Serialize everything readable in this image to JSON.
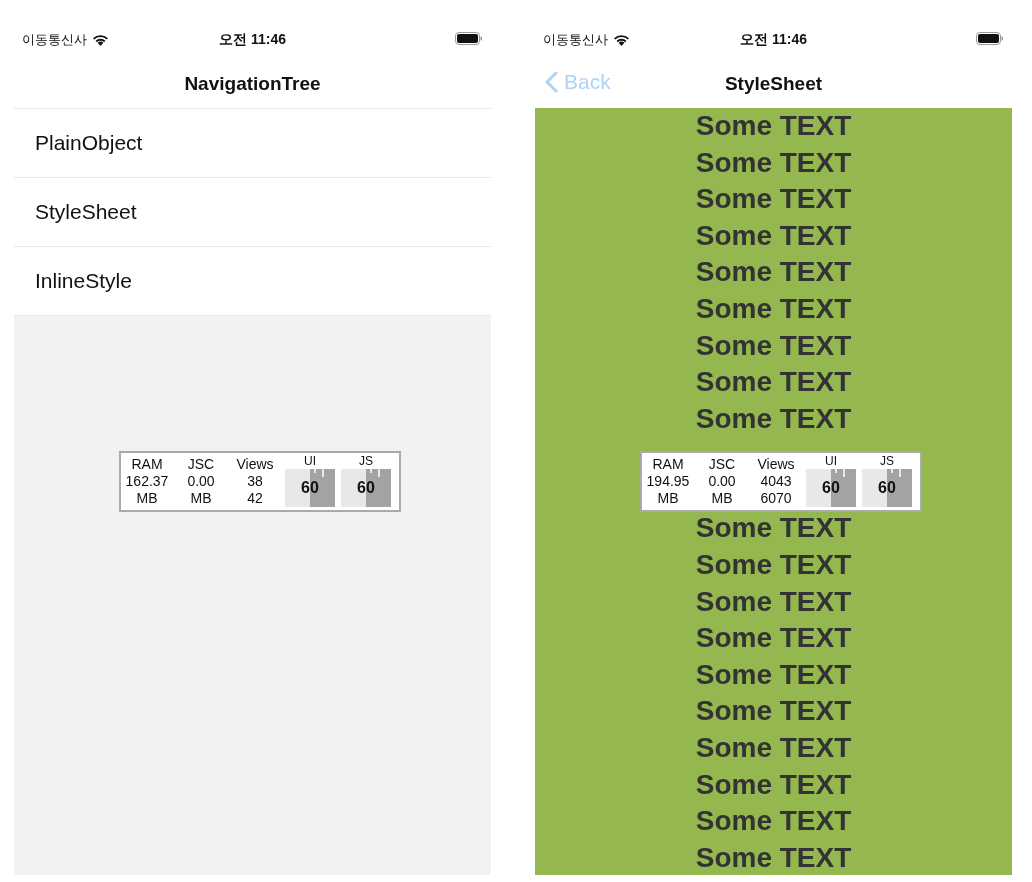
{
  "screens": [
    {
      "status_bar": {
        "carrier": "이동통신사",
        "time": "오전 11:46"
      },
      "nav_bar": {
        "title": "NavigationTree"
      },
      "content": {
        "kind": "list",
        "items": [
          "PlainObject",
          "StyleSheet",
          "InlineStyle"
        ]
      },
      "perf_monitor": {
        "stats": [
          {
            "label": "RAM",
            "lines": [
              "162.37",
              "MB"
            ]
          },
          {
            "label": "JSC",
            "lines": [
              "0.00",
              "MB"
            ]
          },
          {
            "label": "Views",
            "lines": [
              "38",
              "42"
            ]
          }
        ],
        "graphs": [
          {
            "label": "UI",
            "value": "60"
          },
          {
            "label": "JS",
            "value": "60"
          }
        ]
      }
    },
    {
      "status_bar": {
        "carrier": "이동통신사",
        "time": "오전 11:46"
      },
      "nav_bar": {
        "back": "Back",
        "title": "StyleSheet"
      },
      "content": {
        "kind": "text_stack",
        "items": [
          "Some TEXT",
          "Some TEXT",
          "Some TEXT",
          "Some TEXT",
          "Some TEXT",
          "Some TEXT",
          "Some TEXT",
          "Some TEXT",
          "Some TEXT",
          "Some TEXT",
          "Some TEXT",
          "Some TEXT",
          "Some TEXT",
          "Some TEXT",
          "Some TEXT",
          "Some TEXT",
          "Some TEXT",
          "Some TEXT",
          "Some TEXT"
        ]
      },
      "perf_monitor": {
        "stats": [
          {
            "label": "RAM",
            "lines": [
              "194.95",
              "MB"
            ]
          },
          {
            "label": "JSC",
            "lines": [
              "0.00",
              "MB"
            ]
          },
          {
            "label": "Views",
            "lines": [
              "4043",
              "6070"
            ]
          }
        ],
        "graphs": [
          {
            "label": "UI",
            "value": "60"
          },
          {
            "label": "JS",
            "value": "60"
          }
        ]
      }
    }
  ]
}
